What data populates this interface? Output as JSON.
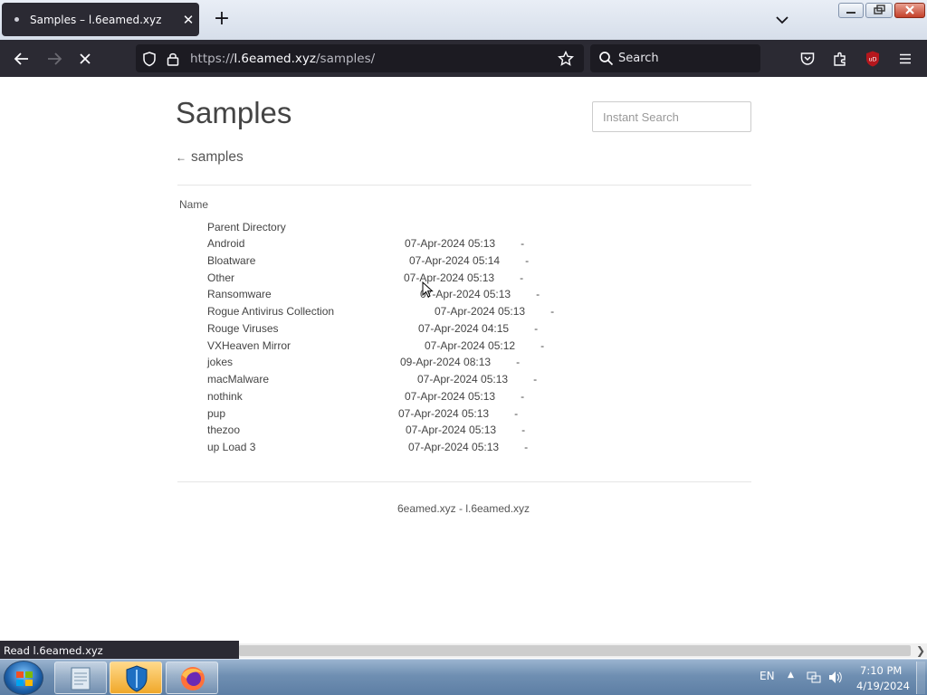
{
  "browser": {
    "tab_title": "Samples – l.6eamed.xyz",
    "url_prefix": "https://",
    "url_host": "l.6eamed.xyz",
    "url_path": "/samples/",
    "search_placeholder": "Search",
    "status_text": "Read l.6eamed.xyz"
  },
  "page": {
    "title": "Samples",
    "search_placeholder": "Instant Search",
    "breadcrumb_arrow": "←",
    "breadcrumb": "samples",
    "col_name": "Name",
    "parent": "Parent Directory",
    "entries": [
      {
        "name": "Android",
        "modified": "07-Apr-2024 05:13",
        "size": "-"
      },
      {
        "name": "Bloatware",
        "modified": "07-Apr-2024 05:14",
        "size": "-"
      },
      {
        "name": "Other",
        "modified": "07-Apr-2024 05:13",
        "size": "-"
      },
      {
        "name": "Ransomware",
        "modified": "07-Apr-2024 05:13",
        "size": "-"
      },
      {
        "name": "Rogue Antivirus Collection",
        "modified": "07-Apr-2024 05:13",
        "size": "-"
      },
      {
        "name": "Rouge Viruses",
        "modified": "07-Apr-2024 04:15",
        "size": "-"
      },
      {
        "name": "VXHeaven Mirror",
        "modified": "07-Apr-2024 05:12",
        "size": "-"
      },
      {
        "name": "jokes",
        "modified": "09-Apr-2024 08:13",
        "size": "-"
      },
      {
        "name": "macMalware",
        "modified": "07-Apr-2024 05:13",
        "size": "-"
      },
      {
        "name": "nothink",
        "modified": "07-Apr-2024 05:13",
        "size": "-"
      },
      {
        "name": "pup",
        "modified": "07-Apr-2024 05:13",
        "size": "-"
      },
      {
        "name": "thezoo",
        "modified": "07-Apr-2024 05:13",
        "size": "-"
      },
      {
        "name": "up Load 3",
        "modified": "07-Apr-2024 05:13",
        "size": "-"
      }
    ],
    "footer": "6eamed.xyz - l.6eamed.xyz"
  },
  "taskbar": {
    "language": "EN",
    "time": "7:10 PM",
    "date": "4/19/2024"
  },
  "colors": {
    "browser_chrome": "#2b2a33",
    "urlbar_bg": "#1c1b22",
    "page_bg": "#ffffff",
    "ublock_red": "#b5171d"
  }
}
